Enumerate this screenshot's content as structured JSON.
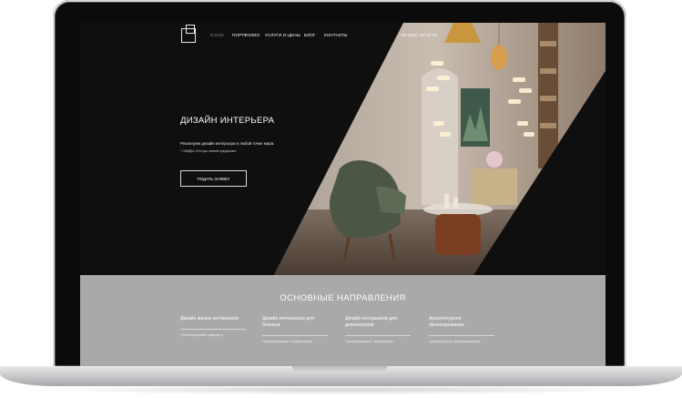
{
  "nav": {
    "items": [
      {
        "label": "О нас",
        "active": true
      },
      {
        "label": "Портфолио",
        "active": false
      },
      {
        "label": "Услуги и цены",
        "active": false
      },
      {
        "label": "Блог",
        "active": false
      },
      {
        "label": "Контакты",
        "active": false
      }
    ],
    "phone": "+38 (044) 757 67 67"
  },
  "hero": {
    "title": "Дизайн интерьера",
    "subtitle": "Реализуем дизайн интерьера в любой точке мира.",
    "note": "* СКИДКА 10% при полной предоплате",
    "button_label": "Подать заявку"
  },
  "directions": {
    "title": "Основные направления",
    "columns": [
      {
        "title": "Дизайн жилых интерьеров",
        "desc": "Проектирование квартир и"
      },
      {
        "title": "Дизайн интерьеров для бизнеса",
        "desc": "Проектирование коммерческих"
      },
      {
        "title": "Дизайн интерьеров для девелоперов",
        "desc": "Проектирование, энергоэкспе"
      },
      {
        "title": "Архитектурное проектирование",
        "desc": "Архитектурное проектирование"
      }
    ]
  },
  "colors": {
    "hero_bg": "#0f0f10",
    "section_bg": "#a9a9a9",
    "text": "#ffffff"
  }
}
